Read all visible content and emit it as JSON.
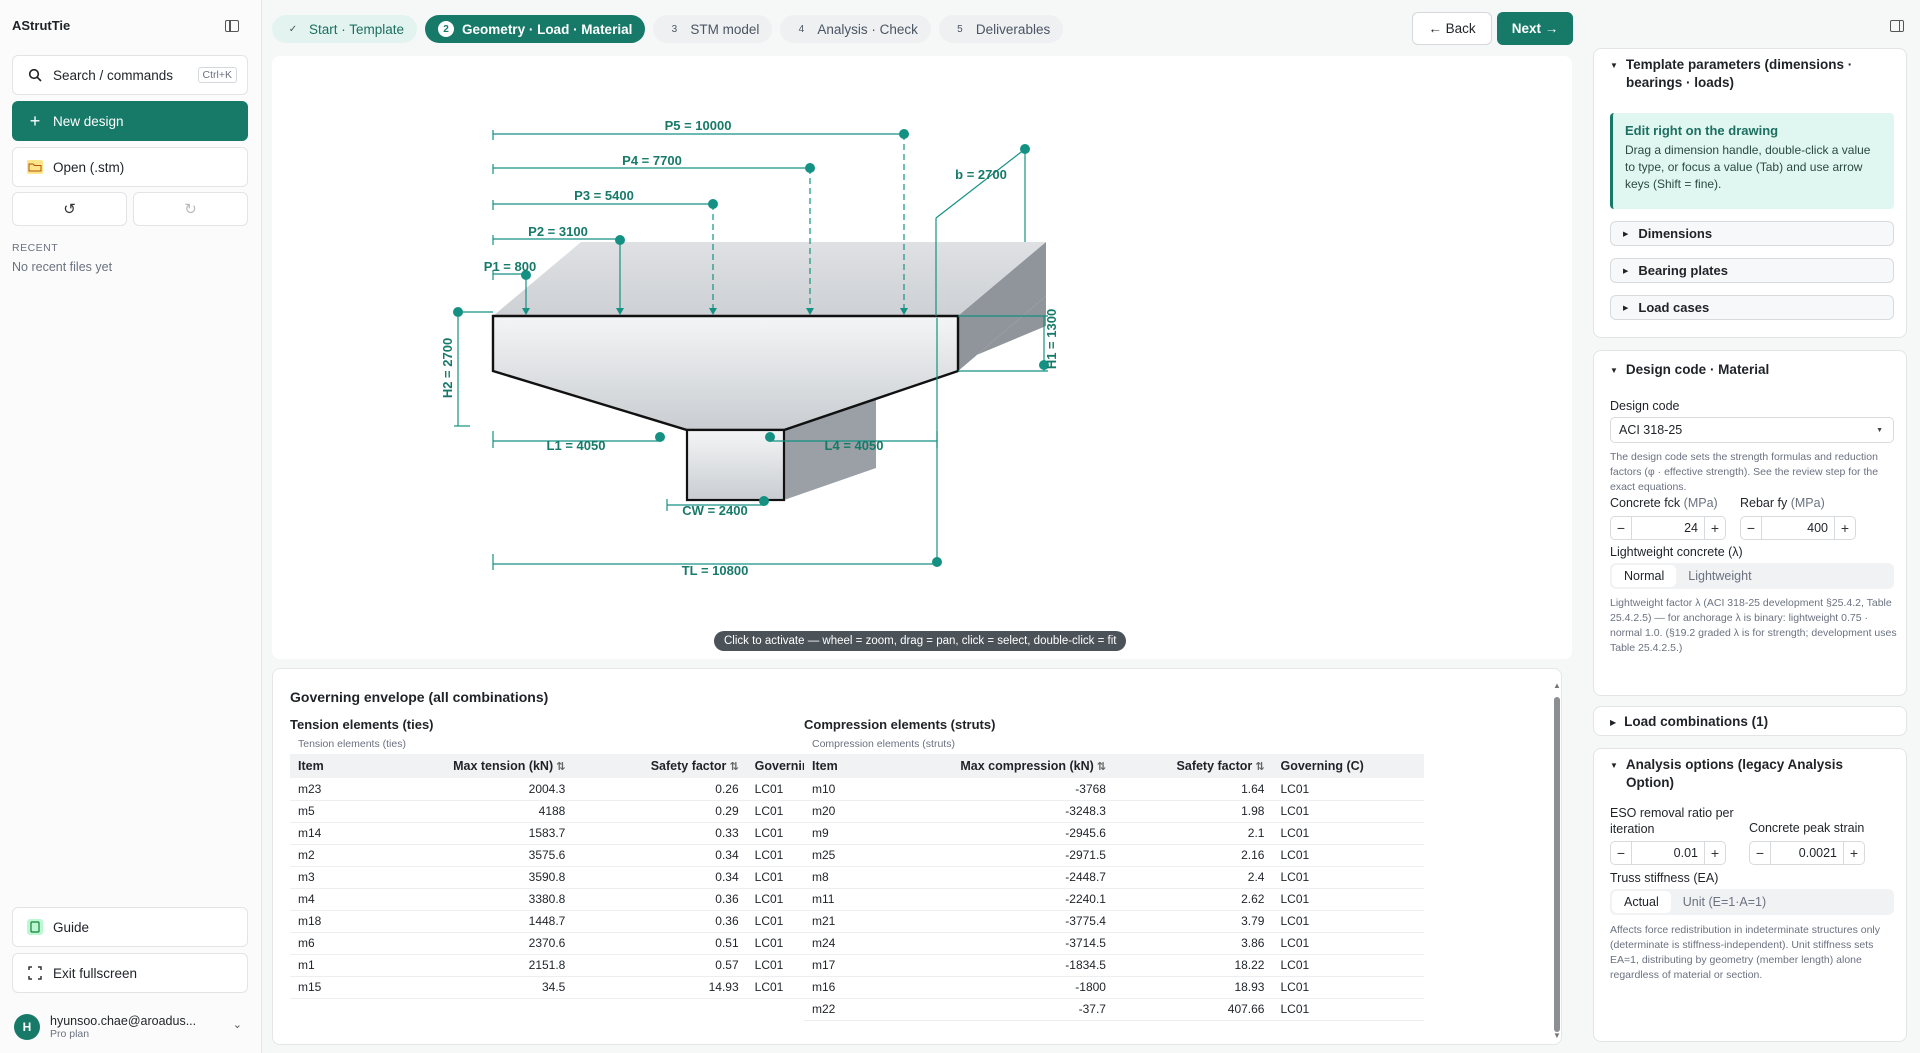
{
  "sidebar": {
    "brand": "AStrutTie",
    "search_label": "Search / commands",
    "search_shortcut": "Ctrl+K",
    "new_design_label": "New design",
    "open_label": "Open (.stm)",
    "recent_heading": "RECENT",
    "recent_empty": "No recent files yet",
    "guide_label": "Guide",
    "exit_fullscreen_label": "Exit fullscreen",
    "user_initial": "H",
    "user_email": "hyunsoo.chae@aroadus...",
    "user_plan": "Pro plan"
  },
  "steps": [
    {
      "num": "✓",
      "label": "Start · Template",
      "state": "done"
    },
    {
      "num": "2",
      "label": "Geometry · Load · Material",
      "state": "active"
    },
    {
      "num": "3",
      "label": "STM model",
      "state": "todo"
    },
    {
      "num": "4",
      "label": "Analysis · Check",
      "state": "todo"
    },
    {
      "num": "5",
      "label": "Deliverables",
      "state": "todo"
    }
  ],
  "nav": {
    "back_label": "← Back",
    "next_label": "Next →"
  },
  "drawing": {
    "labels": {
      "p5": "P5 = 10000",
      "p4": "P4 = 7700",
      "p3": "P3 = 5400",
      "p2": "P2 = 3100",
      "p1": "P1 = 800",
      "b": "b = 2700",
      "h1": "H1 = 1300",
      "h2": "H2 = 2700",
      "l1": "L1 = 4050",
      "l4": "L4 = 4050",
      "cw": "CW = 2400",
      "tl": "TL = 10800"
    },
    "hint": "Click to activate — wheel = zoom, drag = pan, click = select, double-click = fit",
    "accent": "#149183"
  },
  "results": {
    "title": "Governing envelope (all combinations)",
    "tension": {
      "heading": "Tension elements (ties)",
      "caption": "Tension elements (ties)",
      "columns": [
        "Item",
        "Max tension (kN)",
        "Safety factor",
        "Governing (T)"
      ],
      "rows": [
        [
          "m23",
          "2004.3",
          "0.26",
          "LC01"
        ],
        [
          "m5",
          "4188",
          "0.29",
          "LC01"
        ],
        [
          "m14",
          "1583.7",
          "0.33",
          "LC01"
        ],
        [
          "m2",
          "3575.6",
          "0.34",
          "LC01"
        ],
        [
          "m3",
          "3590.8",
          "0.34",
          "LC01"
        ],
        [
          "m4",
          "3380.8",
          "0.36",
          "LC01"
        ],
        [
          "m18",
          "1448.7",
          "0.36",
          "LC01"
        ],
        [
          "m6",
          "2370.6",
          "0.51",
          "LC01"
        ],
        [
          "m1",
          "2151.8",
          "0.57",
          "LC01"
        ],
        [
          "m15",
          "34.5",
          "14.93",
          "LC01"
        ]
      ]
    },
    "compression": {
      "heading": "Compression elements (struts)",
      "caption": "Compression elements (struts)",
      "columns": [
        "Item",
        "Max compression (kN)",
        "Safety factor",
        "Governing (C)"
      ],
      "rows": [
        [
          "m10",
          "-3768",
          "1.64",
          "LC01"
        ],
        [
          "m20",
          "-3248.3",
          "1.98",
          "LC01"
        ],
        [
          "m9",
          "-2945.6",
          "2.1",
          "LC01"
        ],
        [
          "m25",
          "-2971.5",
          "2.16",
          "LC01"
        ],
        [
          "m8",
          "-2448.7",
          "2.4",
          "LC01"
        ],
        [
          "m11",
          "-2240.1",
          "2.62",
          "LC01"
        ],
        [
          "m21",
          "-3775.4",
          "3.79",
          "LC01"
        ],
        [
          "m24",
          "-3714.5",
          "3.86",
          "LC01"
        ],
        [
          "m17",
          "-1834.5",
          "18.22",
          "LC01"
        ],
        [
          "m16",
          "-1800",
          "18.93",
          "LC01"
        ],
        [
          "m22",
          "-37.7",
          "407.66",
          "LC01"
        ]
      ]
    }
  },
  "panel": {
    "template": {
      "title": "Template parameters (dimensions · bearings · loads)",
      "callout_title": "Edit right on the drawing",
      "callout_text": "Drag a dimension handle, double-click a value to type, or focus a value (Tab) and use arrow keys (Shift = fine).",
      "sections": [
        "Dimensions",
        "Bearing plates",
        "Load cases"
      ]
    },
    "design": {
      "title": "Design code · Material",
      "code_label": "Design code",
      "code_value": "ACI 318-25",
      "code_help": "The design code sets the strength formulas and reduction factors (φ · effective strength). See the review step for the exact equations.",
      "fck_label": "Concrete fck",
      "fck_unit": "(MPa)",
      "fck_value": "24",
      "fy_label": "Rebar fy",
      "fy_unit": "(MPa)",
      "fy_value": "400",
      "lw_label": "Lightweight concrete (λ)",
      "lw_options": [
        "Normal",
        "Lightweight"
      ],
      "lw_help": "Lightweight factor λ (ACI 318-25 development §25.4.2, Table 25.4.2.5) — for anchorage λ is binary: lightweight 0.75 · normal 1.0. (§19.2 graded λ is for strength; development uses Table 25.4.2.5.)"
    },
    "combos": {
      "title": "Load combinations (1)"
    },
    "analysis": {
      "title": "Analysis options (legacy Analysis Option)",
      "eso_label": "ESO removal ratio per iteration",
      "eso_value": "0.01",
      "strain_label": "Concrete peak strain",
      "strain_value": "0.0021",
      "stiff_label": "Truss stiffness (EA)",
      "stiff_options": [
        "Actual",
        "Unit (E=1·A=1)"
      ],
      "stiff_help": "Affects force redistribution in indeterminate structures only (determinate is stiffness-independent). Unit stiffness sets EA=1, distributing by geometry (member length) alone regardless of material or section."
    }
  }
}
